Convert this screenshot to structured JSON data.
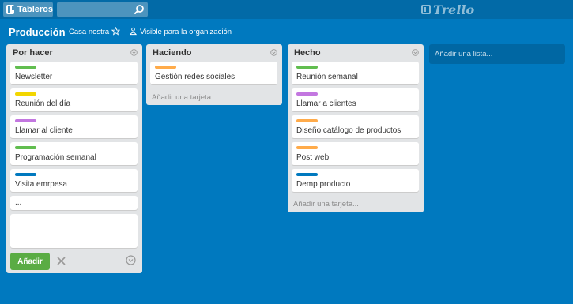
{
  "topbar": {
    "boards_label": "Tableros",
    "search_value": "",
    "logo_text": "Trello"
  },
  "board": {
    "title": "Producción",
    "team": "Casa nostra",
    "visibility": "Visible para la organización"
  },
  "colors": {
    "background": "#0079bf",
    "green": "#61bd4f",
    "yellow": "#f2d600",
    "purple": "#c377e0",
    "orange": "#ffab4a",
    "blue": "#0079bf",
    "add_button": "#5aac44"
  },
  "lists": [
    {
      "title": "Por hacer",
      "cards": [
        {
          "label_color": "green",
          "text": "Newsletter"
        },
        {
          "label_color": "yellow",
          "text": "Reunión del día"
        },
        {
          "label_color": "purple",
          "text": "Llamar al cliente"
        },
        {
          "label_color": "green",
          "text": "Programación semanal"
        },
        {
          "label_color": "blue",
          "text": "Visita emrpesa"
        }
      ],
      "extra_card": "...",
      "composer": {
        "value": "",
        "add_label": "Añadir"
      }
    },
    {
      "title": "Haciendo",
      "cards": [
        {
          "label_color": "orange",
          "text": "Gestión redes sociales"
        }
      ],
      "add_card_label": "Añadir una tarjeta..."
    },
    {
      "title": "Hecho",
      "cards": [
        {
          "label_color": "green",
          "text": "Reunión semanal"
        },
        {
          "label_color": "purple",
          "text": "Llamar a clientes"
        },
        {
          "label_color": "orange",
          "text": "Diseño catálogo de productos"
        },
        {
          "label_color": "orange",
          "text": "Post web"
        },
        {
          "label_color": "blue",
          "text": "Demp producto"
        }
      ],
      "add_card_label": "Añadir una tarjeta..."
    }
  ],
  "add_list_label": "Añadir una lista..."
}
